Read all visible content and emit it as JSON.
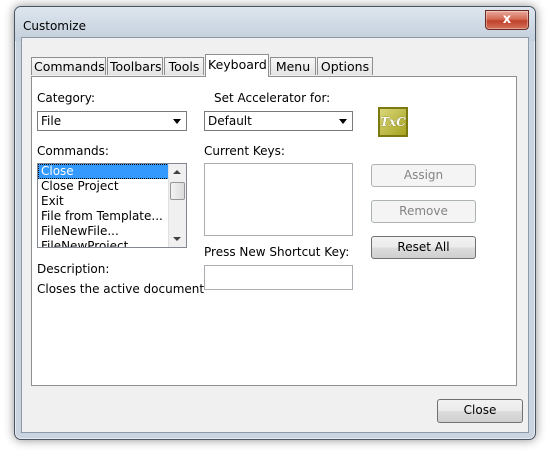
{
  "window": {
    "title": "Customize",
    "close_glyph": "x"
  },
  "tabs": [
    {
      "label": "Commands"
    },
    {
      "label": "Toolbars"
    },
    {
      "label": "Tools"
    },
    {
      "label": "Keyboard"
    },
    {
      "label": "Menu"
    },
    {
      "label": "Options"
    }
  ],
  "active_tab": "Keyboard",
  "keyboard": {
    "category_label": "Category:",
    "category_value": "File",
    "accelerator_label": "Set Accelerator for:",
    "accelerator_value": "Default",
    "app_icon_text": "TxC",
    "commands_label": "Commands:",
    "commands": [
      "Close",
      "Close Project",
      "Exit",
      "File from Template...",
      "FileNewFile...",
      "FileNewProject..."
    ],
    "selected_command": "Close",
    "current_keys_label": "Current Keys:",
    "current_keys": [],
    "shortcut_label": "Press New Shortcut Key:",
    "shortcut_value": "",
    "description_label": "Description:",
    "description_value": "Closes the active document",
    "assign_label": "Assign",
    "remove_label": "Remove",
    "reset_all_label": "Reset All"
  },
  "footer": {
    "close_label": "Close"
  },
  "colors": {
    "selection": "#3399ff",
    "accent_icon": "#a8a320"
  }
}
